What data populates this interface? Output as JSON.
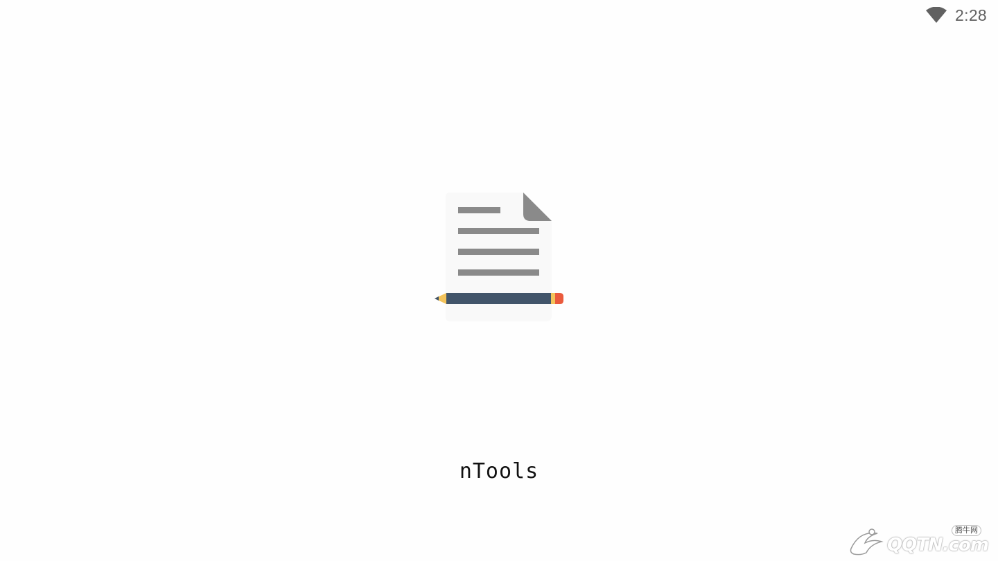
{
  "status_bar": {
    "time": "2:28",
    "wifi_icon": "wifi-signal-icon"
  },
  "splash": {
    "logo_icon": "document-with-pencil-icon",
    "app_name": "nTools"
  },
  "colors": {
    "background": "#fefefe",
    "status_text": "#616161",
    "document_fill": "#f9f9f9",
    "document_lines": "#8a8a8a",
    "pencil_body": "#42556a",
    "pencil_tip": "#f3c35a",
    "pencil_eraser": "#ea5a3c"
  },
  "watermark": {
    "brand": "QQTN.com",
    "tag": "腾牛网"
  }
}
